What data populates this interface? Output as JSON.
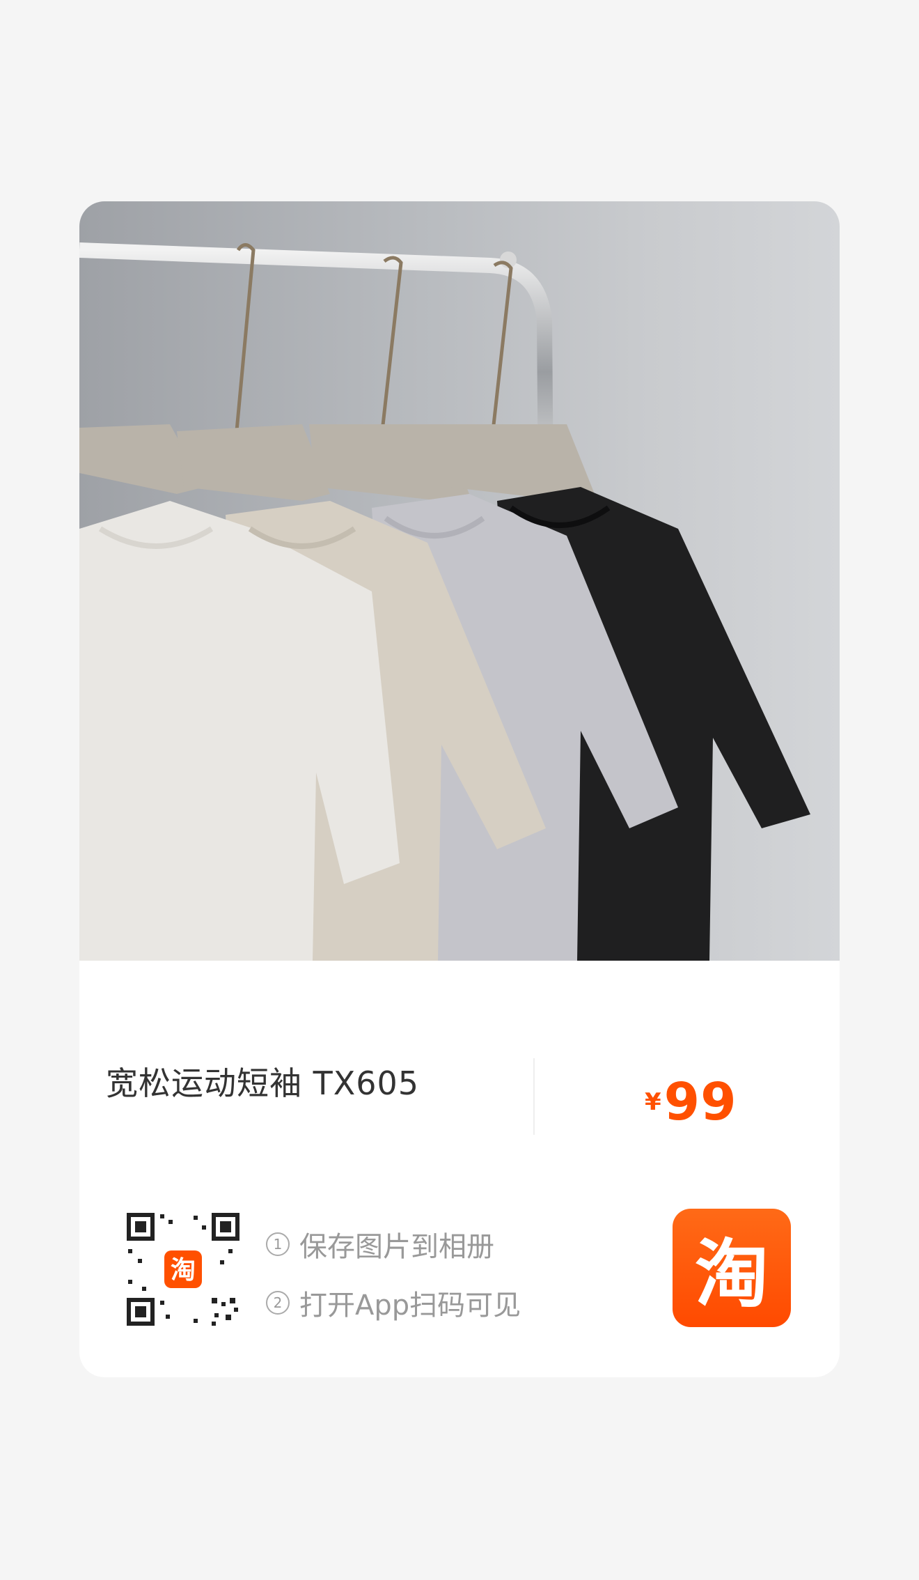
{
  "product": {
    "title": "宽松运动短袖 TX605",
    "price_currency": "¥",
    "price_value": "99"
  },
  "share": {
    "steps": [
      {
        "num": "1",
        "text": "保存图片到相册"
      },
      {
        "num": "2",
        "text": "打开App扫码可见"
      }
    ],
    "qr_badge": "淘",
    "app_icon_text": "淘"
  },
  "colors": {
    "background": "#f5f5f5",
    "card": "#ffffff",
    "accent": "#ff5000",
    "title_text": "#333333",
    "muted_text": "#999999"
  },
  "icons": {
    "app": "taobao-app-icon",
    "qr": "qr-code-icon"
  }
}
